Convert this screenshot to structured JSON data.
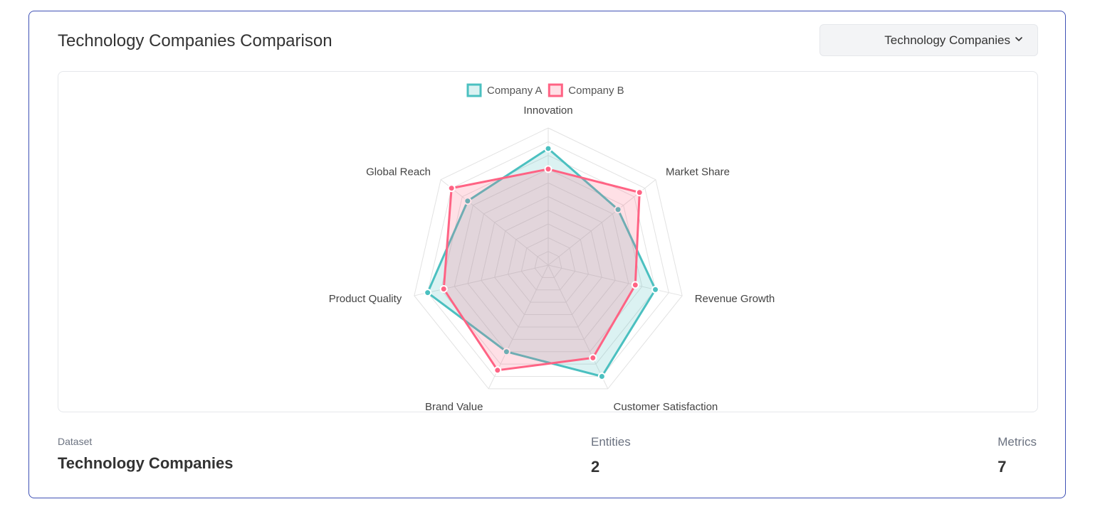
{
  "header": {
    "title": "Technology Companies Comparison",
    "dropdown_value": "Technology Companies"
  },
  "stats": {
    "dataset_label": "Dataset",
    "dataset_value": "Technology Companies",
    "entities_label": "Entities",
    "entities_value": "2",
    "metrics_label": "Metrics",
    "metrics_value": "7"
  },
  "chart_data": {
    "type": "radar",
    "title": "",
    "axes": [
      "Innovation",
      "Market Share",
      "Revenue Growth",
      "Customer Satisfaction",
      "Brand Value",
      "Product Quality",
      "Global Reach"
    ],
    "range": [
      0,
      100
    ],
    "series": [
      {
        "name": "Company A",
        "values": [
          85,
          65,
          80,
          90,
          70,
          90,
          75
        ],
        "color": "#4bc0c0"
      },
      {
        "name": "Company B",
        "values": [
          70,
          85,
          65,
          75,
          85,
          78,
          90
        ],
        "color": "#ff6384"
      }
    ],
    "legend": "top-center",
    "grid": true
  }
}
